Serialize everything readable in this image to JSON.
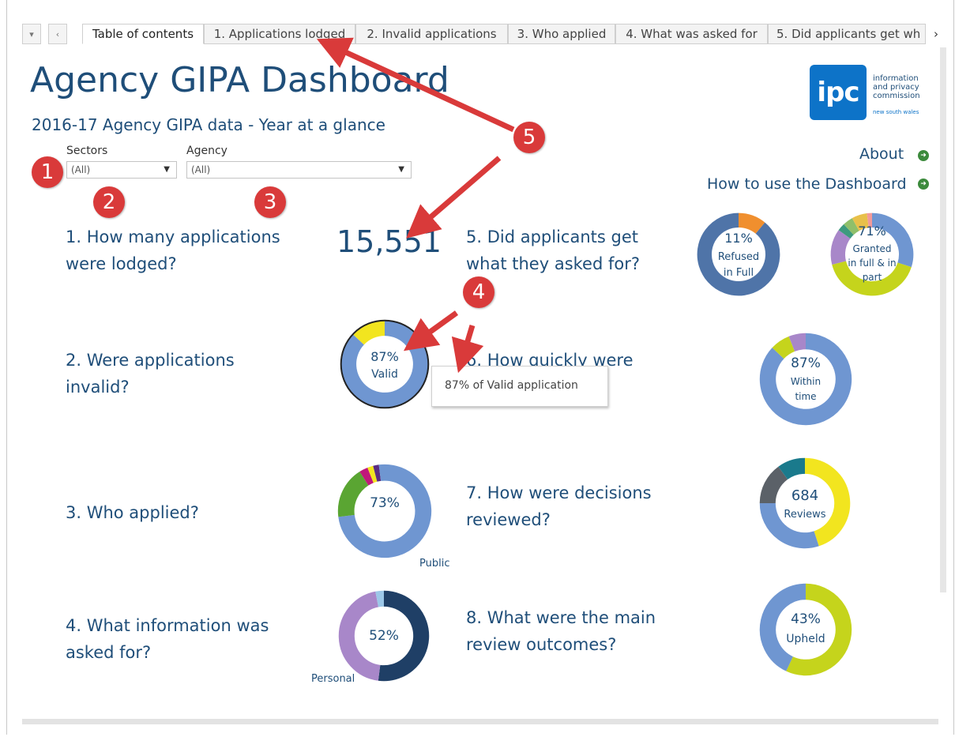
{
  "tabs": [
    {
      "label": "Table of contents",
      "active": true
    },
    {
      "label": "1. Applications lodged"
    },
    {
      "label": "2. Invalid applications"
    },
    {
      "label": "3. Who applied"
    },
    {
      "label": "4. What was asked for"
    },
    {
      "label": "5. Did applicants get wh"
    }
  ],
  "tab_controls": {
    "menu": "▾",
    "prev": "‹",
    "next": "›"
  },
  "header": {
    "title": "Agency GIPA Dashboard",
    "subtitle": "2016-17 Agency GIPA data - Year at a glance"
  },
  "filters": {
    "sectors": {
      "label": "Sectors",
      "value": "(All)"
    },
    "agency": {
      "label": "Agency",
      "value": "(All)"
    }
  },
  "logo": {
    "mark": "ipc",
    "line1": "information",
    "line2": "and privacy",
    "line3": "commission",
    "line4": "new south wales"
  },
  "links": {
    "about": "About",
    "how_to": "How to use the Dashboard"
  },
  "questions": {
    "q1": "1. How many applications were lodged?",
    "q2": "2. Were applications invalid?",
    "q3": "3. Who applied?",
    "q4": "4. What information was asked for?",
    "q5": "5. Did applicants get what they asked for?",
    "q6": "6. How quickly were",
    "q7": "7. How were decisions reviewed?",
    "q8": "8. What were the main review outcomes?"
  },
  "applications_lodged": "15,551",
  "tooltip": "87% of  Valid application",
  "callouts": [
    "1",
    "2",
    "3",
    "4",
    "5"
  ],
  "colors": {
    "blue": "#6f96d1",
    "navy": "#1f3f66",
    "yellow": "#f2e51f",
    "lime": "#c5d41c",
    "orange": "#f08f2e",
    "purple": "#a887c9",
    "green": "#5aa532",
    "gray": "#5b6168",
    "teal": "#1a7a8c",
    "callout_red": "#d93a3a"
  },
  "chart_data": [
    {
      "type": "pie",
      "id": "q2-valid",
      "center_text": "87%",
      "center_sub": "Valid",
      "slices": [
        {
          "name": "Valid",
          "value": 87,
          "color": "#6f96d1"
        },
        {
          "name": "Invalid",
          "value": 13,
          "color": "#f2e51f"
        }
      ]
    },
    {
      "type": "pie",
      "id": "q3-who",
      "center_text": "73%",
      "side_label": "Public",
      "slices": [
        {
          "value": 73,
          "color": "#6f96d1"
        },
        {
          "value": 18,
          "color": "#5aa532"
        },
        {
          "value": 3,
          "color": "#c0187a"
        },
        {
          "value": 2,
          "color": "#f2e51f"
        },
        {
          "value": 2,
          "color": "#5a2d82"
        },
        {
          "value": 2,
          "color": "#6f96d1"
        }
      ]
    },
    {
      "type": "pie",
      "id": "q4-info",
      "center_text": "52%",
      "side_label": "Personal",
      "slices": [
        {
          "value": 52,
          "color": "#1f3f66"
        },
        {
          "value": 45,
          "color": "#a887c9"
        },
        {
          "value": 3,
          "color": "#9cc7e8"
        }
      ]
    },
    {
      "type": "pie",
      "id": "q5-refused",
      "center_text": "11%",
      "center_sub": "Refused",
      "center_sub2": "in Full",
      "slices": [
        {
          "value": 11,
          "color": "#f08f2e"
        },
        {
          "value": 89,
          "color": "#4f74a8"
        }
      ]
    },
    {
      "type": "pie",
      "id": "q5-granted",
      "center_text": "71%",
      "center_sub": "Granted",
      "center_sub2": "in full & in",
      "center_sub3": "part",
      "slices": [
        {
          "value": 30,
          "color": "#6f96d1"
        },
        {
          "value": 41,
          "color": "#c5d41c"
        },
        {
          "value": 14,
          "color": "#a887c9"
        },
        {
          "value": 3,
          "color": "#3d9a7e"
        },
        {
          "value": 4,
          "color": "#8fbf6a"
        },
        {
          "value": 6,
          "color": "#e8c04a"
        },
        {
          "value": 2,
          "color": "#f29a9a"
        }
      ]
    },
    {
      "type": "pie",
      "id": "q6-time",
      "center_text": "87%",
      "center_sub": "Within",
      "center_sub2": "time",
      "slices": [
        {
          "value": 87,
          "color": "#6f96d1"
        },
        {
          "value": 7,
          "color": "#c5d41c"
        },
        {
          "value": 6,
          "color": "#a887c9"
        }
      ]
    },
    {
      "type": "pie",
      "id": "q7-reviews",
      "center_text": "684",
      "center_sub": "Reviews",
      "slices": [
        {
          "value": 45,
          "color": "#f2e51f"
        },
        {
          "value": 30,
          "color": "#6f96d1"
        },
        {
          "value": 15,
          "color": "#5b6168"
        },
        {
          "value": 10,
          "color": "#1a7a8c"
        }
      ]
    },
    {
      "type": "pie",
      "id": "q8-outcomes",
      "center_text": "43%",
      "center_sub": "Upheld",
      "slices": [
        {
          "value": 57,
          "color": "#c5d41c"
        },
        {
          "value": 43,
          "color": "#6f96d1"
        }
      ]
    }
  ]
}
